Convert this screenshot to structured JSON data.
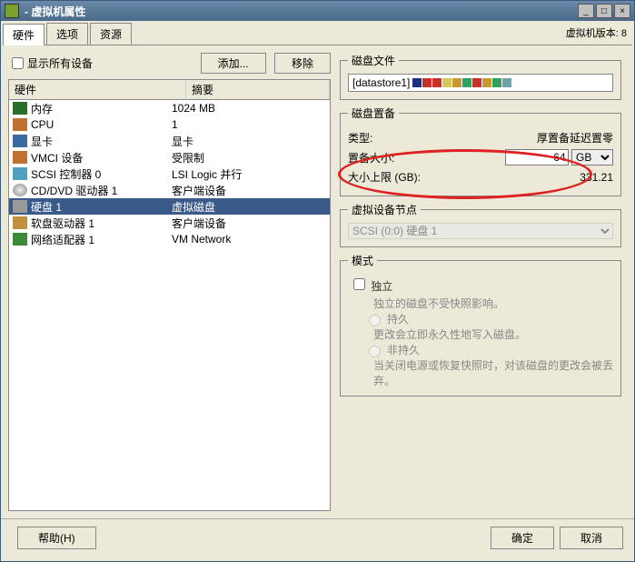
{
  "window": {
    "title": "- 虚拟机属性"
  },
  "tabs": {
    "items": [
      {
        "label": "硬件",
        "active": true
      },
      {
        "label": "选项",
        "active": false
      },
      {
        "label": "资源",
        "active": false
      }
    ],
    "version": "虚拟机版本: 8"
  },
  "showAll": {
    "label": "显示所有设备"
  },
  "buttons": {
    "add": "添加...",
    "remove": "移除"
  },
  "columns": {
    "hw": "硬件",
    "summary": "摘要"
  },
  "rows": [
    {
      "icon": "ic-mem",
      "name": "内存",
      "summary": "1024 MB"
    },
    {
      "icon": "ic-cpu",
      "name": "CPU",
      "summary": "1"
    },
    {
      "icon": "ic-video",
      "name": "显卡",
      "summary": "显卡"
    },
    {
      "icon": "ic-vmci",
      "name": "VMCI 设备",
      "summary": "受限制"
    },
    {
      "icon": "ic-scsi",
      "name": "SCSI 控制器 0",
      "summary": "LSI Logic 并行"
    },
    {
      "icon": "ic-cd",
      "name": "CD/DVD 驱动器 1",
      "summary": "客户端设备"
    },
    {
      "icon": "ic-hdd",
      "name": "硬盘 1",
      "summary": "虚拟磁盘",
      "selected": true
    },
    {
      "icon": "ic-floppy",
      "name": "软盘驱动器 1",
      "summary": "客户端设备"
    },
    {
      "icon": "ic-net",
      "name": "网络适配器 1",
      "summary": "VM Network"
    }
  ],
  "diskFile": {
    "legend": "磁盘文件",
    "value": "[datastore1]",
    "stripes": [
      "#203080",
      "#c83028",
      "#c83028",
      "#d8c858",
      "#c89830",
      "#30a060",
      "#c83028",
      "#c89830",
      "#30a060",
      "#70a0a8"
    ]
  },
  "provision": {
    "legend": "磁盘置备",
    "typeLabel": "类型:",
    "typeValue": "厚置备延迟置零",
    "sizeLabel": "置备大小:",
    "sizeValue": "64",
    "sizeUnit": "GB",
    "maxLabel": "大小上限 (GB):",
    "maxValue": "331.21"
  },
  "vnode": {
    "legend": "虚拟设备节点",
    "value": "SCSI (0:0) 硬盘 1"
  },
  "mode": {
    "legend": "模式",
    "independent": "独立",
    "desc": "独立的磁盘不受快照影响。",
    "persistent": "持久",
    "persistentDesc": "更改会立即永久性地写入磁盘。",
    "nonpersistent": "非持久",
    "nonpersistentDesc": "当关闭电源或恢复快照时，对该磁盘的更改会被丢弃。"
  },
  "footer": {
    "help": "帮助(H)",
    "ok": "确定",
    "cancel": "取消"
  }
}
